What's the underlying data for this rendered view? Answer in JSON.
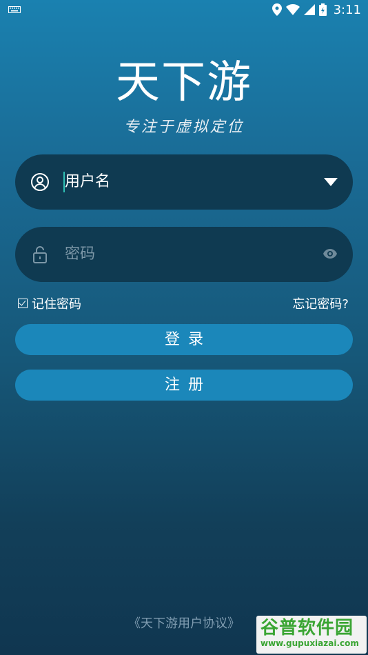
{
  "status_bar": {
    "time": "3:11",
    "icons": [
      "keyboard-icon",
      "location-icon",
      "wifi-icon",
      "signal-icon",
      "battery-icon"
    ]
  },
  "app": {
    "title": "天下游",
    "slogan": "专注于虚拟定位"
  },
  "login_form": {
    "username": {
      "value": "用户名",
      "icon": "user-icon",
      "trailing_icon": "dropdown-arrow-icon"
    },
    "password": {
      "placeholder": "密码",
      "icon": "lock-icon",
      "trailing_icon": "eye-icon"
    },
    "remember_label": "记住密码",
    "remember_checked": true,
    "forgot_label": "忘记密码?",
    "login_label": "登录",
    "register_label": "注册"
  },
  "footer": {
    "agreement": "《天下游用户协议》"
  },
  "watermark": {
    "title": "谷普软件园",
    "url": "www.gupuxiazai.com"
  },
  "colors": {
    "background_top": "#1a81b0",
    "background_bottom": "#103650",
    "field_bg": "#0f3a51",
    "button_bg": "#1b87ba",
    "cursor": "#2fc0b4"
  }
}
